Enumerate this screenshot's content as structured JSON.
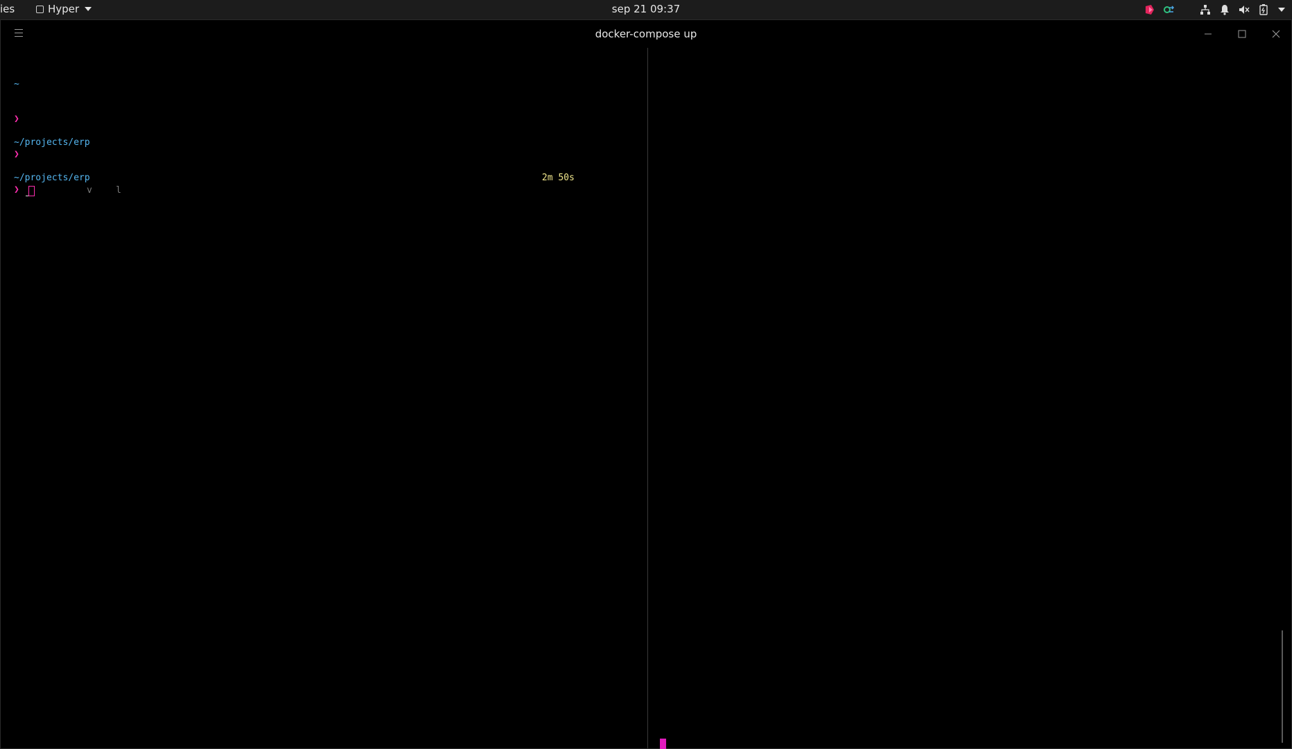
{
  "topbar": {
    "activities": "ies",
    "app_name": "Hyper",
    "clock": "sep 21  09:37",
    "tray_icons": [
      "app-indicator-icon",
      "sync-icon",
      "network-icon",
      "notification-bell-icon",
      "volume-icon",
      "battery-icon",
      "system-menu-caret-icon"
    ]
  },
  "window": {
    "title": "docker-compose up"
  },
  "terminal_left": {
    "lines": [
      {
        "text": "~",
        "kind": "path"
      },
      {
        "text": "❯",
        "kind": "prompt"
      },
      {
        "text": "~/projects/erp",
        "kind": "path"
      },
      {
        "text": "❯",
        "kind": "prompt"
      },
      {
        "text": "~/projects/erp",
        "kind": "path"
      },
      {
        "text": "❯",
        "kind": "prompt"
      }
    ],
    "duration": "2m 50s",
    "ghost_1": "v",
    "ghost_2": "l"
  },
  "colors": {
    "path": "#55b6f0",
    "prompt": "#ff2fb0",
    "duration": "#f0e68c",
    "cursor": "#e11bbd"
  }
}
